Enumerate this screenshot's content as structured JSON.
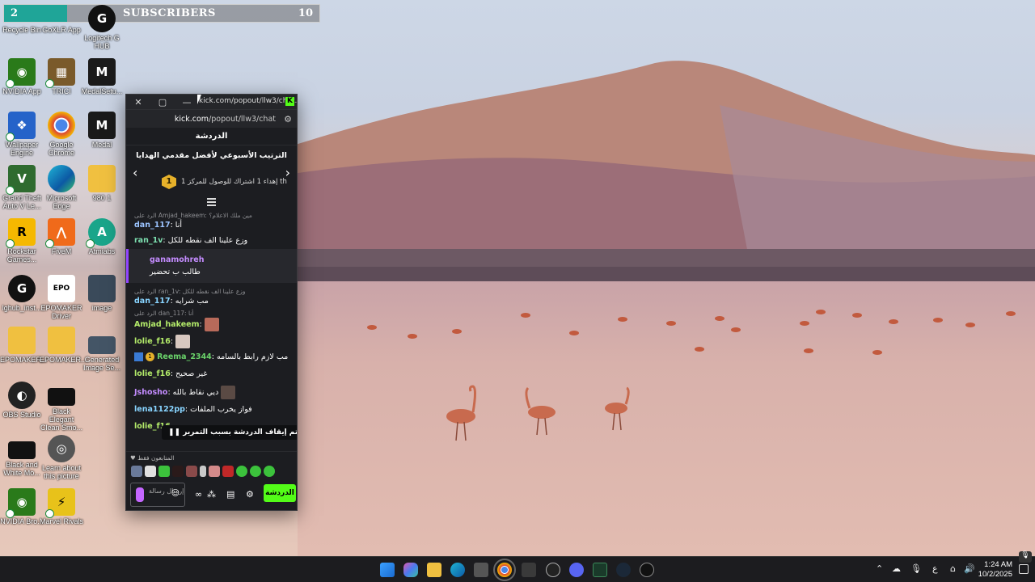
{
  "subscriber_bar": {
    "current": "2",
    "title": "SUBSCRIBERS",
    "goal": "10",
    "progress": 0.2
  },
  "desktop_icons": [
    {
      "label": "Recycle Bin",
      "icon": "recycle-bin-icon"
    },
    {
      "label": "GoXLR App",
      "icon": "goxlr-icon"
    },
    {
      "label": "Logitech G HUB",
      "icon": "logitech-icon"
    },
    {
      "label": "NVIDIA App",
      "icon": "nvidia-icon"
    },
    {
      "label": "TRICI",
      "icon": "trici-icon"
    },
    {
      "label": "MedalSetu...",
      "icon": "medal-icon"
    },
    {
      "label": "Wallpaper Engine",
      "icon": "wallpaper-engine-icon"
    },
    {
      "label": "Google Chrome",
      "icon": "chrome-icon"
    },
    {
      "label": "Medal",
      "icon": "medal-icon"
    },
    {
      "label": "Grand Theft Auto V Le...",
      "icon": "gta-icon"
    },
    {
      "label": "Microsoft Edge",
      "icon": "edge-icon"
    },
    {
      "label": "980 1",
      "icon": "folder-icon"
    },
    {
      "label": "Rockstar Games...",
      "icon": "rockstar-icon"
    },
    {
      "label": "FiveM",
      "icon": "fivem-icon"
    },
    {
      "label": "Atmiabs",
      "icon": "atmiabs-icon"
    },
    {
      "label": "lghub_inst...",
      "icon": "logitech-icon"
    },
    {
      "label": "EPOMAKER Driver",
      "icon": "epomaker-icon"
    },
    {
      "label": "image",
      "icon": "image-icon"
    },
    {
      "label": "EPOMAKER...",
      "icon": "folder-icon"
    },
    {
      "label": "EPOMAKER...",
      "icon": "folder-icon"
    },
    {
      "label": "Generated Image Se...",
      "icon": "image-icon"
    },
    {
      "label": "OBS Studio",
      "icon": "obs-icon"
    },
    {
      "label": "Black Elegant Clean Smo...",
      "icon": "video-icon"
    },
    {
      "label": "Black and White Mo...",
      "icon": "video-icon"
    },
    {
      "label": "Learn about this picture",
      "icon": "camera-icon"
    },
    {
      "label": "NVIDIA Bro...",
      "icon": "nvidia-icon"
    },
    {
      "label": "Marvel Rivals",
      "icon": "marvel-rivals-icon"
    }
  ],
  "popout": {
    "window_title": "kick.com/popout/llw3/chat...",
    "url_domain": "kick.com",
    "url_path": "/popout/llw3/chat",
    "header": "الدردشة",
    "leaderboard": {
      "title": "الترتيب الأسبوعي لأفضل مقدمي الهدايا",
      "rank": "1",
      "subtitle": "إهداء 1 اشتراك للوصول للمركز 1 th"
    },
    "messages": [
      {
        "type": "reply",
        "text": "الرد على Amjad_hakeem: مين ملك الاعلام؟"
      },
      {
        "type": "msg",
        "user": "dan_117",
        "text": "أنا"
      },
      {
        "type": "msg",
        "user": "ran_1v",
        "text": "وزع علينا الف نقطه للكل"
      },
      {
        "type": "highlight",
        "user": "ganamohreh",
        "text": "طالب ب تحضير"
      },
      {
        "type": "reply",
        "text": "الرد على ran_1v: وزع علينا الف نقطه للكل"
      },
      {
        "type": "msg",
        "user": "dan_117",
        "text": "مب شرايه"
      },
      {
        "type": "reply",
        "text": "الرد على dan_117: أنا"
      },
      {
        "type": "msg",
        "user": "Amjad_hakeem",
        "text": ""
      },
      {
        "type": "msg",
        "user": "lolie_f16",
        "text": ""
      },
      {
        "type": "msg",
        "user": "Reema_2344",
        "badge": "1",
        "text": "مب لازم رابط بالسامه"
      },
      {
        "type": "msg",
        "user": "lolie_f16",
        "text": "غير صحيح"
      },
      {
        "type": "msg",
        "user": "Jshosho",
        "text": "ديي نقاط بالله"
      },
      {
        "type": "msg",
        "user": "lena1122pp",
        "text": "فواز يخرب الملفات"
      },
      {
        "type": "msg",
        "user": "lolie_f16",
        "text": ""
      }
    ],
    "paused_notice": "تم إيقاف الدردشة بسبب التمرير",
    "followers_only": "المتابعون فقط",
    "input_placeholder": "إرسال رسالة",
    "send_label": "الدردشة"
  },
  "taskbar": {
    "time": "1:24 AM",
    "date": "10/2/2025",
    "language": "ع"
  },
  "colors": {
    "kick_green": "#53fc18",
    "highlight_purple": "#9146ff"
  }
}
